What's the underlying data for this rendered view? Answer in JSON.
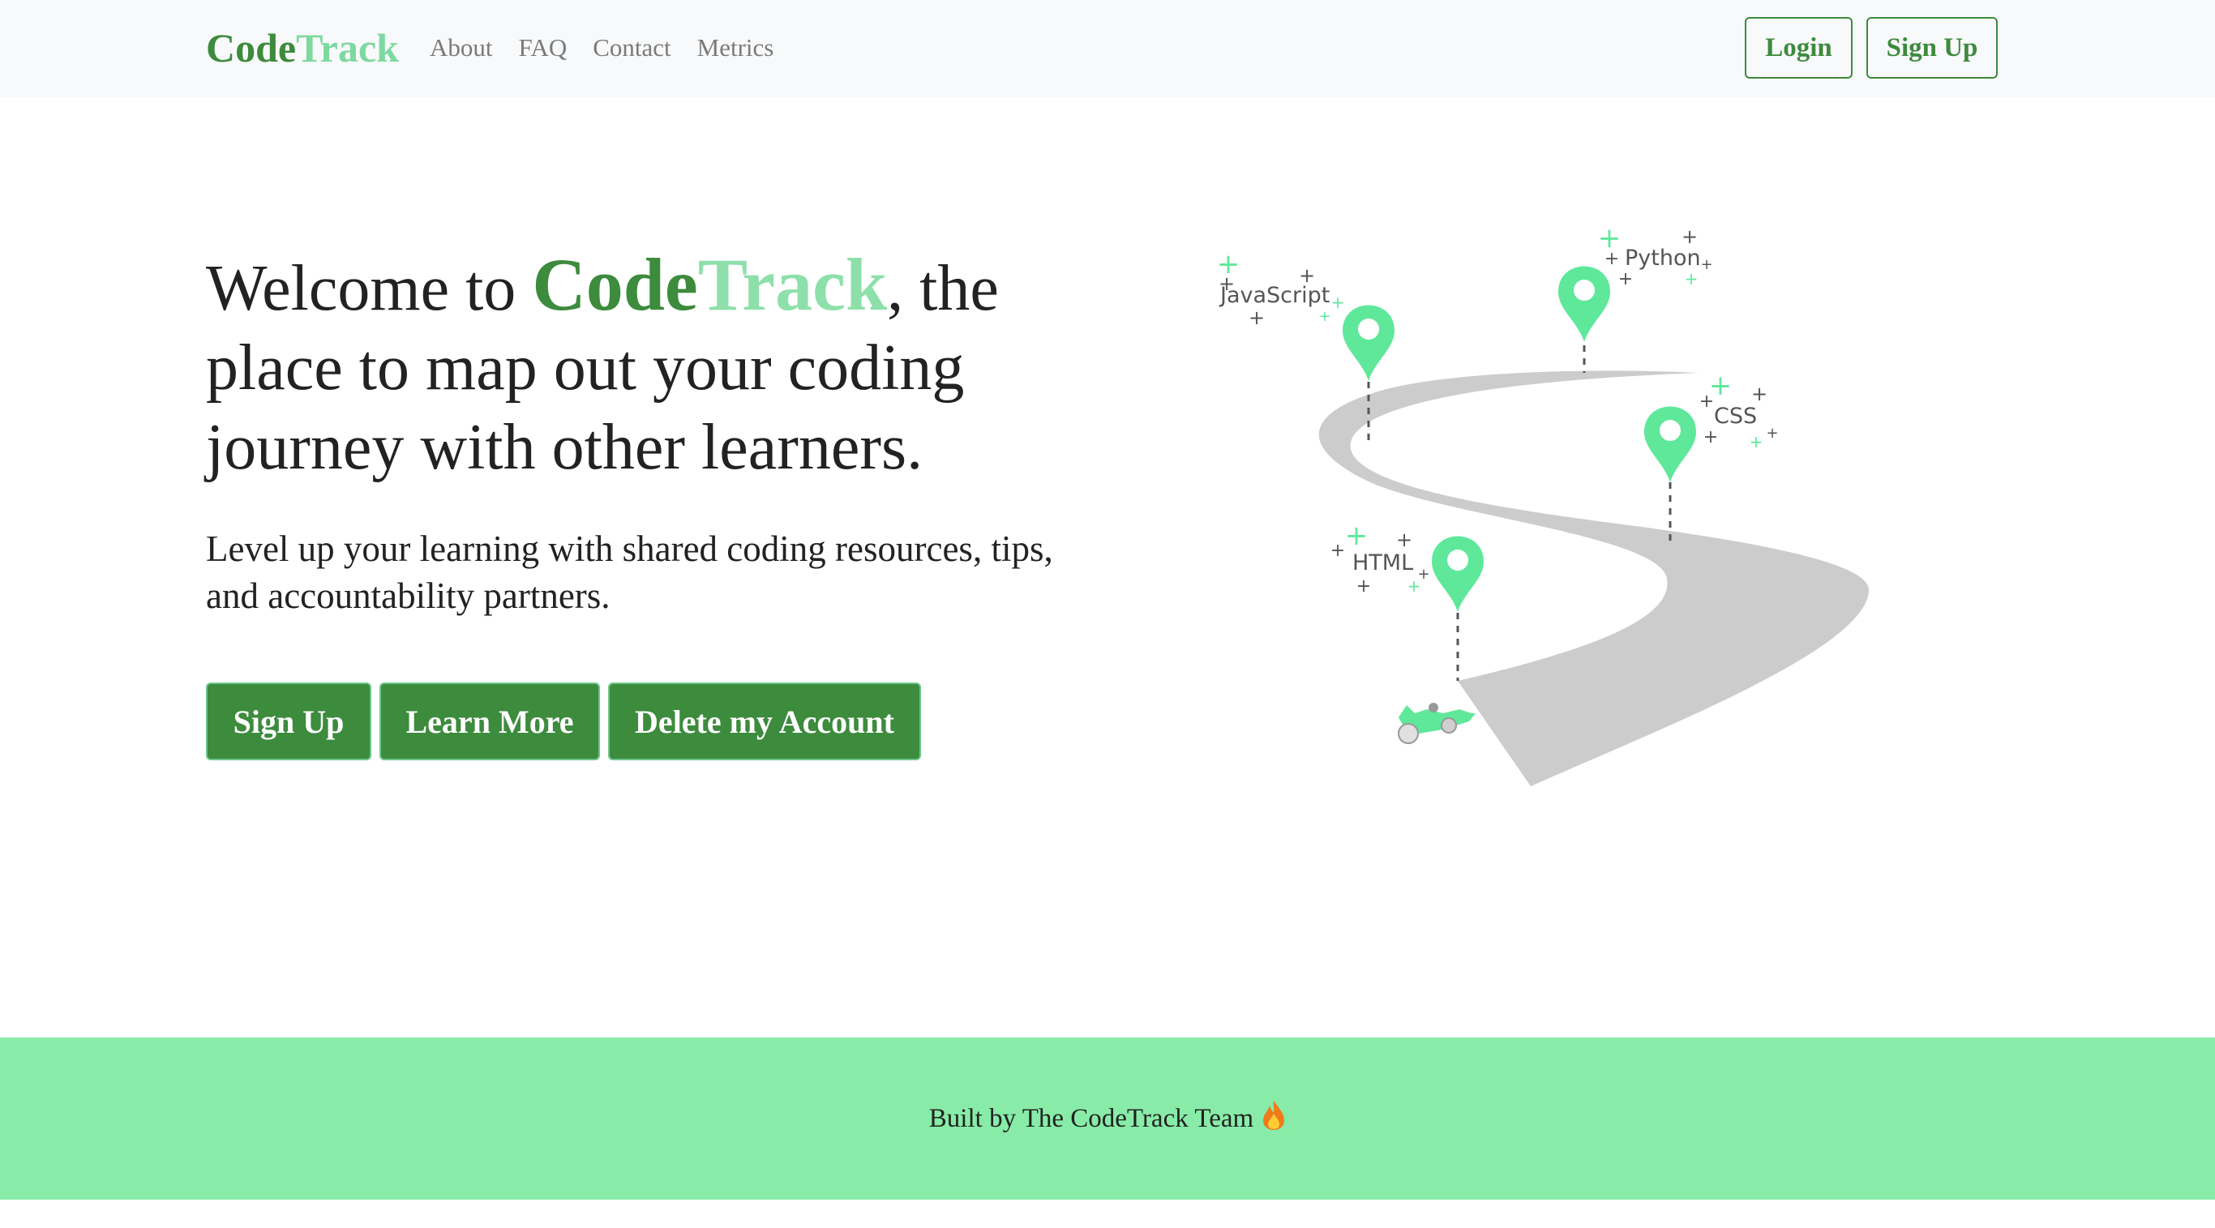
{
  "navbar": {
    "brand_part1": "Code",
    "brand_part2": "Track",
    "links": [
      "About",
      "FAQ",
      "Contact",
      "Metrics"
    ],
    "login_label": "Login",
    "signup_label": "Sign Up"
  },
  "hero": {
    "title_prefix": "Welcome to ",
    "title_brand1": "Code",
    "title_brand2": "Track",
    "title_suffix": ", the place to map out your coding journey with other learners.",
    "subtitle": "Level up your learning with shared coding resources, tips, and accountability partners.",
    "buttons": {
      "signup": "Sign Up",
      "learn_more": "Learn More",
      "delete_account": "Delete my Account"
    }
  },
  "illustration": {
    "pins": [
      "JavaScript",
      "Python",
      "CSS",
      "HTML"
    ],
    "pin_icon": "map-pin-icon",
    "vehicle_icon": "race-car-icon",
    "colors": {
      "road": "#cccccc",
      "pin": "#5fe89a",
      "sparkle_dark": "#555555",
      "sparkle_green": "#5fe89a"
    }
  },
  "footer": {
    "text": "Built by The CodeTrack Team",
    "icon": "flame-icon"
  },
  "colors": {
    "brand_dark_green": "#3d8b3d",
    "brand_light_green": "#8ee0aa",
    "footer_bg": "#88eca8",
    "navbar_bg": "#f8f9fa"
  }
}
